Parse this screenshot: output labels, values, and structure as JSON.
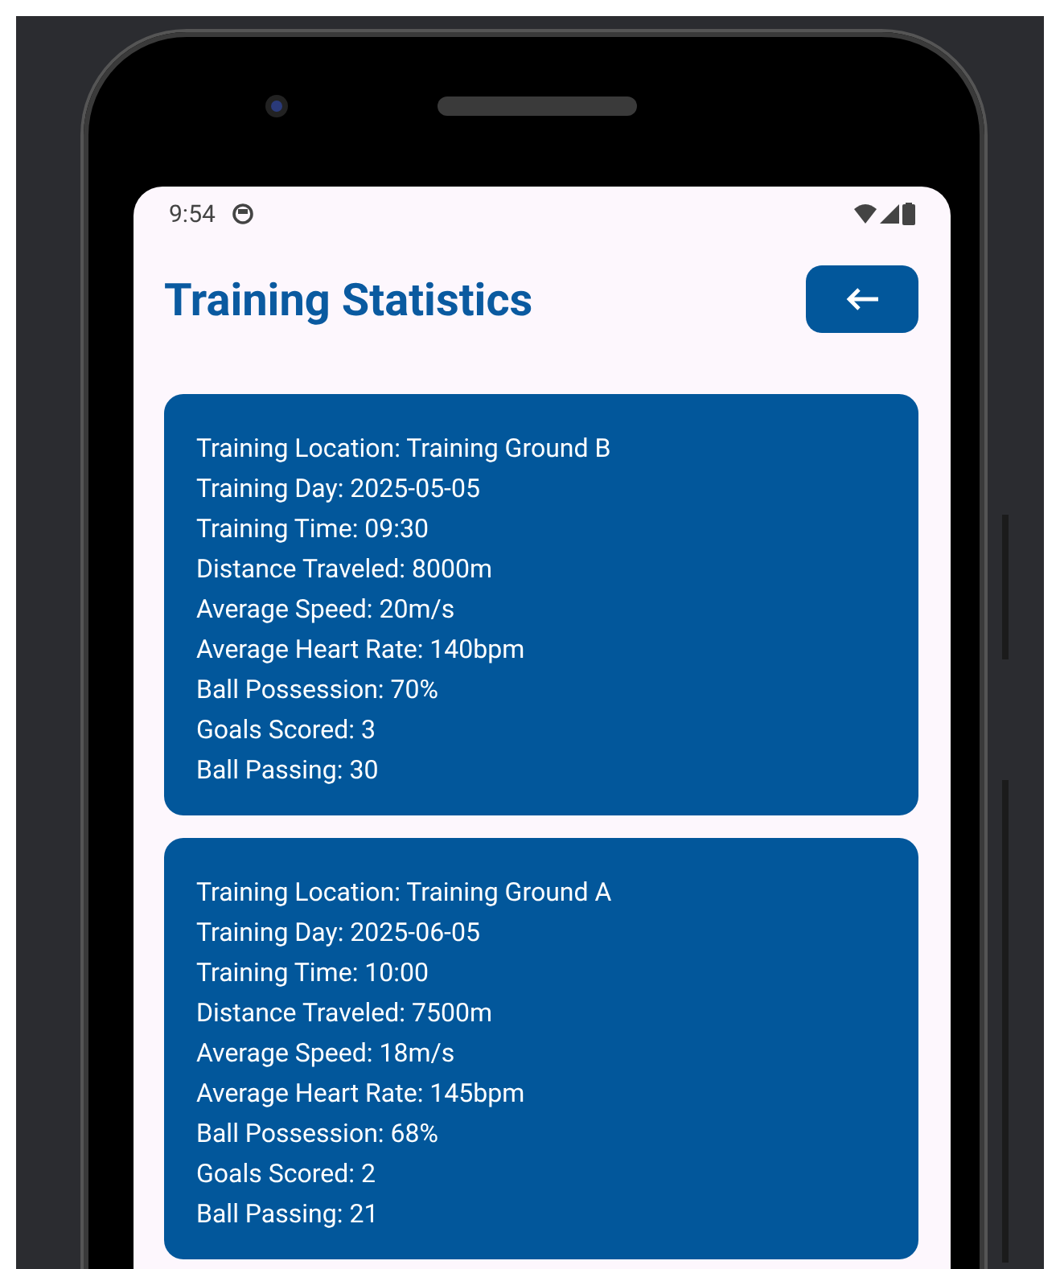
{
  "status_bar": {
    "time": "9:54"
  },
  "header": {
    "title": "Training Statistics"
  },
  "sessions": [
    {
      "lines": [
        "Training Location: Training Ground B",
        "Training Day: 2025-05-05",
        "Training Time: 09:30",
        "Distance Traveled: 8000m",
        "Average Speed: 20m/s",
        "Average Heart Rate: 140bpm",
        "Ball Possession: 70%",
        "Goals Scored: 3",
        "Ball Passing: 30"
      ]
    },
    {
      "lines": [
        "Training Location: Training Ground A",
        "Training Day: 2025-06-05",
        "Training Time: 10:00",
        "Distance Traveled: 7500m",
        "Average Speed: 18m/s",
        "Average Heart Rate: 145bpm",
        "Ball Possession: 68%",
        "Goals Scored: 2",
        "Ball Passing: 21"
      ]
    }
  ]
}
